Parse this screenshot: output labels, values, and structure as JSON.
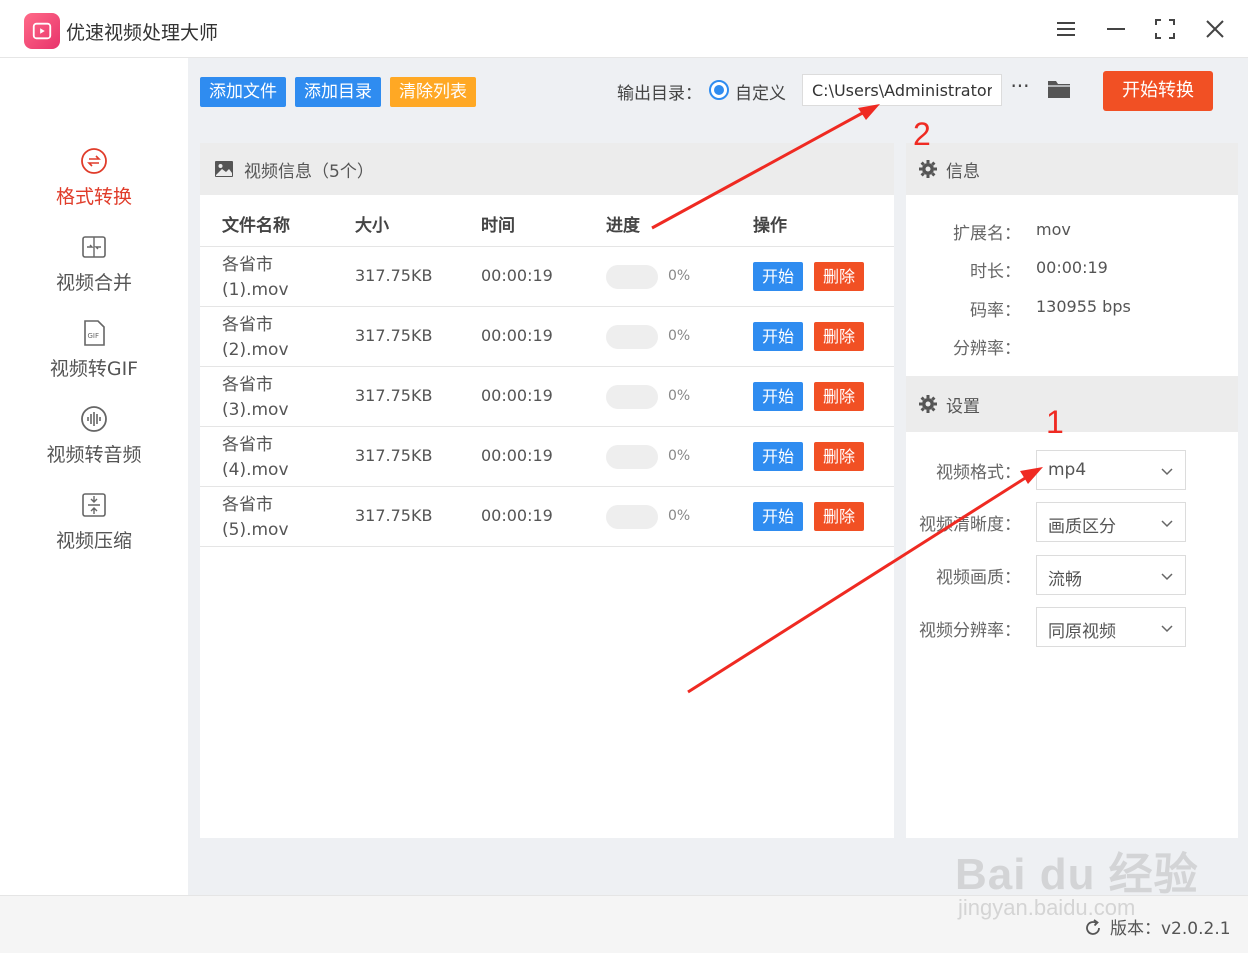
{
  "app": {
    "title": "优速视频处理大师"
  },
  "sidebar": {
    "items": [
      {
        "label": "格式转换",
        "icon": "format-convert-icon"
      },
      {
        "label": "视频合并",
        "icon": "merge-icon"
      },
      {
        "label": "视频转GIF",
        "icon": "gif-icon"
      },
      {
        "label": "视频转音频",
        "icon": "audio-icon"
      },
      {
        "label": "视频压缩",
        "icon": "compress-icon"
      }
    ],
    "active_index": 0
  },
  "toolbar": {
    "add_file": "添加文件",
    "add_dir": "添加目录",
    "clear_list": "清除列表",
    "output_label": "输出目录：",
    "custom_label": "自定义",
    "output_path": "C:\\Users\\Administrator\\",
    "more": "···",
    "start_convert": "开始转换"
  },
  "video_panel": {
    "title": "视频信息（5个）",
    "columns": [
      "文件名称",
      "大小",
      "时间",
      "进度",
      "操作"
    ],
    "rows": [
      {
        "name": "各省市 (1).mov",
        "size": "317.75KB",
        "time": "00:00:19",
        "progress": "0%",
        "progress_value": 0,
        "start": "开始",
        "delete": "删除"
      },
      {
        "name": "各省市 (2).mov",
        "size": "317.75KB",
        "time": "00:00:19",
        "progress": "0%",
        "progress_value": 0,
        "start": "开始",
        "delete": "删除"
      },
      {
        "name": "各省市 (3).mov",
        "size": "317.75KB",
        "time": "00:00:19",
        "progress": "0%",
        "progress_value": 0,
        "start": "开始",
        "delete": "删除"
      },
      {
        "name": "各省市 (4).mov",
        "size": "317.75KB",
        "time": "00:00:19",
        "progress": "0%",
        "progress_value": 0,
        "start": "开始",
        "delete": "删除"
      },
      {
        "name": "各省市 (5).mov",
        "size": "317.75KB",
        "time": "00:00:19",
        "progress": "0%",
        "progress_value": 0,
        "start": "开始",
        "delete": "删除"
      }
    ]
  },
  "info": {
    "title": "信息",
    "fields": [
      {
        "label": "扩展名：",
        "value": "mov"
      },
      {
        "label": "时长：",
        "value": "00:00:19"
      },
      {
        "label": "码率：",
        "value": "130955 bps"
      },
      {
        "label": "分辨率：",
        "value": ""
      }
    ]
  },
  "settings": {
    "title": "设置",
    "fields": [
      {
        "label": "视频格式：",
        "value": "mp4"
      },
      {
        "label": "视频清晰度：",
        "value": "画质区分"
      },
      {
        "label": "视频画质：",
        "value": "流畅"
      },
      {
        "label": "视频分辨率：",
        "value": "同原视频"
      }
    ]
  },
  "status": {
    "version": "版本：v2.0.2.1"
  },
  "annotations": {
    "one": "1",
    "two": "2",
    "color": "#ef2a22"
  },
  "watermark": {
    "brand": "Bai du 经验",
    "url": "jingyan.baidu.com"
  },
  "colors": {
    "primary": "#2f8cf0",
    "danger": "#f15024",
    "warning": "#ffa824",
    "active_nav": "#e03c2a"
  }
}
